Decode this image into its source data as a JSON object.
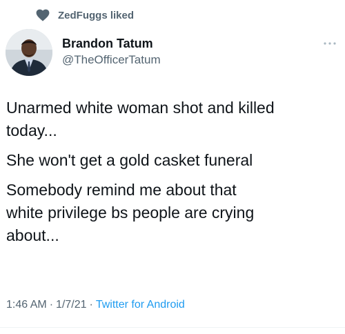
{
  "social_context": {
    "icon": "heart-icon",
    "text": "ZedFuggs liked"
  },
  "author": {
    "display_name": "Brandon Tatum",
    "handle": "@TheOfficerTatum",
    "avatar_icon": "avatar"
  },
  "more_icon": "more-options-icon",
  "tweet": {
    "paragraphs": [
      "Unarmed white woman shot and killed\ntoday...",
      "She won't get a gold casket funeral",
      "Somebody remind me about that\nwhite privilege bs people are crying\nabout..."
    ]
  },
  "meta": {
    "time": "1:46 AM",
    "sep1": "·",
    "date": "1/7/21",
    "sep2": "·",
    "source": "Twitter for Android"
  },
  "colors": {
    "secondary_text": "#536471",
    "link": "#1d9bf0",
    "primary_text": "#0f1419"
  }
}
